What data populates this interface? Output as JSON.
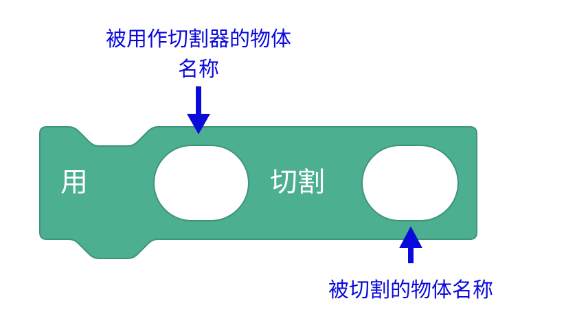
{
  "block": {
    "color": "#4CAF91",
    "border_color": "#3E9478",
    "slot_color": "#FFFFFF",
    "label_use": "用",
    "label_cut": "切割"
  },
  "annotations": {
    "color": "#0A0ADB",
    "top_line1": "被用作切割器的物体",
    "top_line2": "名称",
    "bottom": "被切割的物体名称",
    "top_arrow_icon": "arrow-down-icon",
    "bottom_arrow_icon": "arrow-up-icon"
  }
}
